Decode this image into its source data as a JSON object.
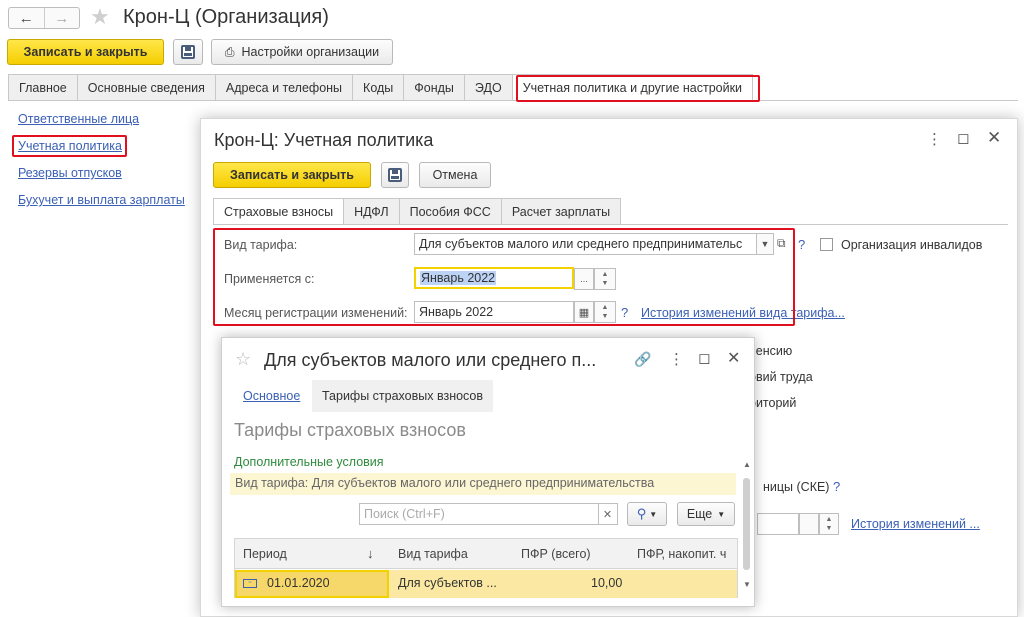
{
  "window": {
    "title": "Крон-Ц (Организация)",
    "save_close": "Записать и закрыть",
    "settings": "Настройки организации"
  },
  "tabs": [
    {
      "label": "Главное"
    },
    {
      "label": "Основные сведения"
    },
    {
      "label": "Адреса и телефоны"
    },
    {
      "label": "Коды"
    },
    {
      "label": "Фонды"
    },
    {
      "label": "ЭДО"
    },
    {
      "label": "Учетная политика и другие настройки"
    }
  ],
  "sidenav": [
    {
      "label": "Ответственные лица"
    },
    {
      "label": "Учетная политика"
    },
    {
      "label": "Резервы отпусков"
    },
    {
      "label": "Бухучет и выплата зарплаты"
    }
  ],
  "dialog": {
    "title": "Крон-Ц: Учетная политика",
    "save_close": "Записать и закрыть",
    "cancel": "Отмена",
    "tabs": [
      {
        "label": "Страховые взносы"
      },
      {
        "label": "НДФЛ"
      },
      {
        "label": "Пособия ФСС"
      },
      {
        "label": "Расчет зарплаты"
      }
    ],
    "tariff_label": "Вид тарифа:",
    "tariff_value": "Для субъектов малого или среднего предпринимательс",
    "disabled_org": "Организация инвалидов",
    "applies_label": "Применяется с:",
    "applies_value": "Январь 2022",
    "reg_month_label": "Месяц регистрации изменений:",
    "reg_month_value": "Январь 2022",
    "history_link": "История изменений вида тарифа...",
    "hidden_1": "пенсию",
    "hidden_2": "овий труда",
    "hidden_3": "риторий",
    "hidden_4": "ницы (СКЕ)",
    "history_link2": "История изменений ...",
    "qmark": "?",
    "dots": "..."
  },
  "popup": {
    "title": "Для субъектов малого или среднего п...",
    "tab_main": "Основное",
    "tab_rates": "Тарифы страховых взносов",
    "heading": "Тарифы страховых взносов",
    "extra_conditions": "Дополнительные условия",
    "tariff_info": "Вид тарифа: Для субъектов малого или среднего предпринимательства",
    "search_placeholder": "Поиск (Ctrl+F)",
    "more": "Еще",
    "columns": [
      "Период",
      "Вид тарифа",
      "ПФР (всего)",
      "ПФР, накопит. ч"
    ],
    "rows": [
      {
        "period": "01.01.2020",
        "tariff": "Для субъектов ...",
        "pfr": "10,00",
        "pfr_acc": ""
      }
    ]
  }
}
